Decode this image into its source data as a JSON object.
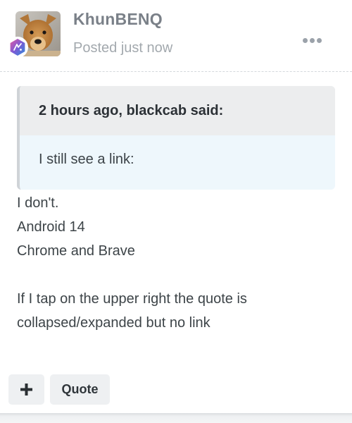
{
  "post": {
    "author": "KhunBENQ",
    "timestamp": "Posted just now",
    "avatar": "dog-photo",
    "rank_icon": "rank-badge-icon",
    "menu_icon": "ellipsis-icon",
    "quote": {
      "header": "2 hours ago, blackcab said:",
      "body": "I still see a link:"
    },
    "lines": [
      "I don't.",
      "Android 14",
      "Chrome and Brave",
      "If I tap on the upper right the quote is",
      "collapsed/expanded but no link"
    ]
  },
  "actions": {
    "plus_icon": "plus-icon",
    "quote_label": "Quote"
  },
  "colors": {
    "author": "#7a8088",
    "quote_header_bg": "#ecedee",
    "quote_body_bg": "#eef7fc",
    "button_bg": "#eef0f2"
  }
}
